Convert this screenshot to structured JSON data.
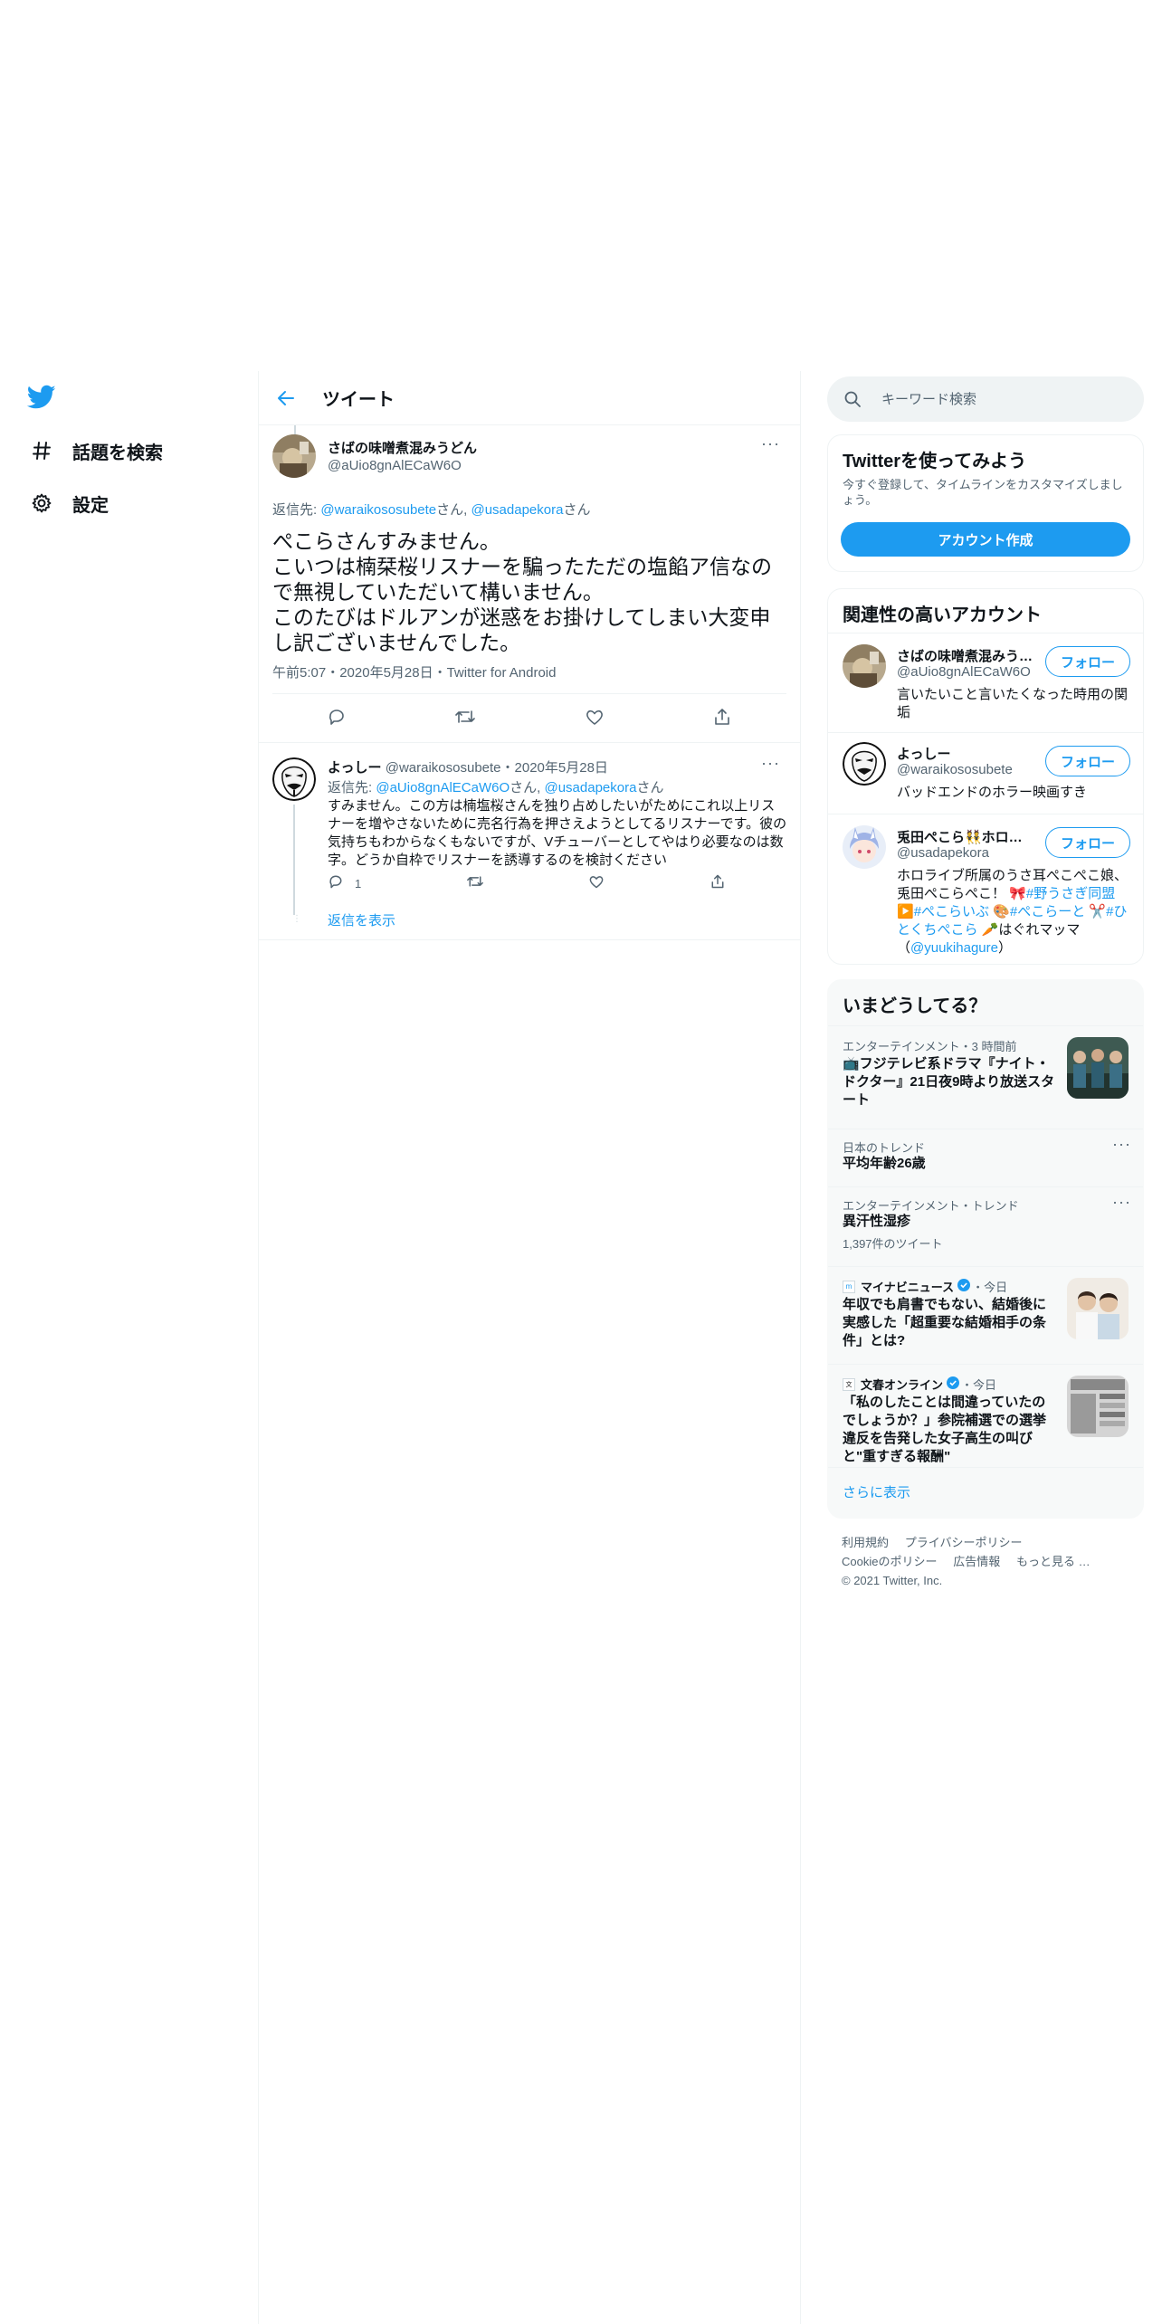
{
  "nav": {
    "logo_icon": "twitter-bird-icon",
    "items": [
      {
        "label": "話題を検索",
        "icon": "hashtag-icon"
      },
      {
        "label": "設定",
        "icon": "gear-icon"
      }
    ]
  },
  "header": {
    "title": "ツイート",
    "back_icon": "arrow-left-icon"
  },
  "main_tweet": {
    "name": "さばの味噌煮混みうどん",
    "handle": "@aUio8gnAlECaW6O",
    "reply_prefix": "返信先: ",
    "reply_to_1": "@waraikososubete",
    "reply_san_1": "さん, ",
    "reply_to_2": "@usadapekora",
    "reply_san_2": "さん",
    "text_line1": "ぺこらさんすみません。",
    "text_line2": "こいつは楠栞桜リスナーを騙ったただの塩餡ア信なので無視していただいて構いません。",
    "text_line3": "このたびはドルアンが迷惑をお掛けしてしまい大変申し訳ございませんでした。",
    "meta": "午前5:07・2020年5月28日・Twitter for Android"
  },
  "reply_tweet": {
    "name": "よっしー",
    "handle": "@waraikososubete",
    "date": "・2020年5月28日",
    "reply_prefix": "返信先: ",
    "reply_to_1": "@aUio8gnAlECaW6O",
    "reply_san_1": "さん, ",
    "reply_to_2": "@usadapekora",
    "reply_san_2": "さん",
    "text": "すみません。この方は楠塩桜さんを独り占めしたいがためにこれ以上リスナーを増やさないために売名行為を押さえようとしてるリスナーです。彼の気持ちもわからなくもないですが、Vチューバーとしてやはり必要なのは数字。どうか自枠でリスナーを誘導するのを検討ください",
    "reply_count": "1",
    "show_replies": "返信を表示"
  },
  "search": {
    "placeholder": "キーワード検索"
  },
  "signup_card": {
    "title": "Twitterを使ってみよう",
    "desc": "今すぐ登録して、タイムラインをカスタマイズしましょう。",
    "button": "アカウント作成"
  },
  "accounts_card": {
    "title": "関連性の高いアカウント",
    "follow_label": "フォロー",
    "accounts": [
      {
        "name": "さばの味噌煮混みう…",
        "handle": "@aUio8gnAlECaW6O",
        "bio": "言いたいこと言いたくなった時用の関垢"
      },
      {
        "name": "よっしー",
        "handle": "@waraikososubete",
        "bio": "バッドエンドのホラー映画すき"
      },
      {
        "name": "兎田ぺこら👯ホロ…",
        "handle": "@usadapekora",
        "bio_1": "ホロライブ所属のうさ耳ぺこぺこ娘、兎田ぺこらぺこ！ 🎀",
        "bio_tag1": "#野うさぎ同盟",
        "bio_2": " ▶️",
        "bio_tag2": "#ぺこらいぶ",
        "bio_3": " 🎨",
        "bio_tag3": "#ぺこらーと",
        "bio_4": " ✂️",
        "bio_tag4": "#ひとくちぺこら",
        "bio_5": " 🥕はぐれマッマ（",
        "bio_link": "@yuukihagure",
        "bio_6": "）"
      }
    ]
  },
  "trends_card": {
    "title": "いまどうしてる？",
    "trends": [
      {
        "meta": "エンターテインメント・3 時間前",
        "title": "📺フジテレビ系ドラマ『ナイト・ドクター』21日夜9時より放送スタート"
      },
      {
        "meta": "日本のトレンド",
        "title": "平均年齢26歳"
      },
      {
        "meta": "エンターテインメント・トレンド",
        "title": "異汗性湿疹",
        "count": "1,397件のツイート"
      },
      {
        "source": "マイナビニュース",
        "time": "・今日",
        "title": "年収でも肩書でもない、結婚後に実感した「超重要な結婚相手の条件」とは?"
      },
      {
        "source": "文春オンライン",
        "time": "・今日",
        "title": "「私のしたことは間違っていたのでしょうか？」参院補選での選挙違反を告発した女子高生の叫びと\"重すぎる報酬\""
      }
    ],
    "show_more": "さらに表示"
  },
  "footer": {
    "terms": "利用規約",
    "privacy": "プライバシーポリシー",
    "cookie": "Cookieのポリシー",
    "ads": "広告情報",
    "more": "もっと見る …",
    "copyright": "© 2021 Twitter, Inc."
  },
  "colors": {
    "accent": "#1d9bf0",
    "text": "#0f1419",
    "muted": "#536471",
    "border": "#eff3f4"
  }
}
